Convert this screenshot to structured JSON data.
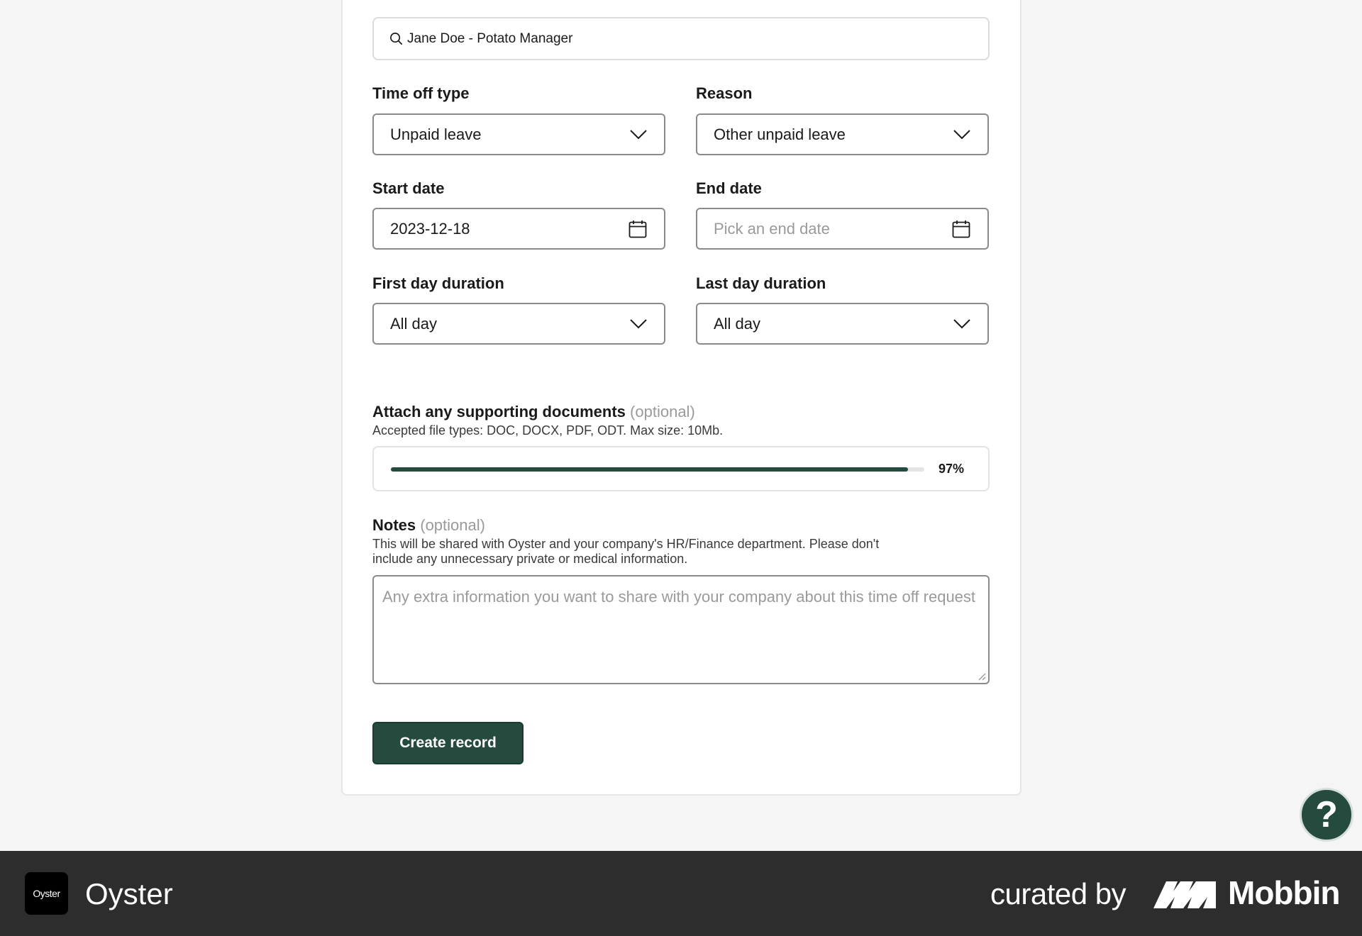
{
  "search": {
    "value": "Jane Doe - Potato Manager",
    "icon": "search-icon"
  },
  "form": {
    "time_off_type": {
      "label": "Time off type",
      "value": "Unpaid leave"
    },
    "reason": {
      "label": "Reason",
      "value": "Other unpaid leave"
    },
    "start_date": {
      "label": "Start date",
      "value": "2023-12-18"
    },
    "end_date": {
      "label": "End date",
      "placeholder": "Pick an end date"
    },
    "first_day_duration": {
      "label": "First day duration",
      "value": "All day"
    },
    "last_day_duration": {
      "label": "Last day duration",
      "value": "All day"
    }
  },
  "attachments": {
    "title": "Attach any supporting documents",
    "optional": "(optional)",
    "helper": "Accepted file types: DOC, DOCX, PDF, ODT. Max size: 10Mb.",
    "progress_fraction": 0.97,
    "progress_label": "97%"
  },
  "notes": {
    "title": "Notes",
    "optional": "(optional)",
    "helper_line1": "This will be shared with Oyster and your company's HR/Finance department. Please don't",
    "helper_line2": "include any unnecessary private or medical information.",
    "placeholder": "Any extra information you want to share with your company about this time off request"
  },
  "actions": {
    "create_label": "Create record"
  },
  "help": {
    "label": "?"
  },
  "footer": {
    "app_logo_text": "Oyster",
    "app_name": "Oyster",
    "curated_by": "curated by",
    "brand": "Mobbin"
  },
  "colors": {
    "accent": "#254a3e",
    "background": "#f5f5f5",
    "footer": "#2d2d2d"
  }
}
